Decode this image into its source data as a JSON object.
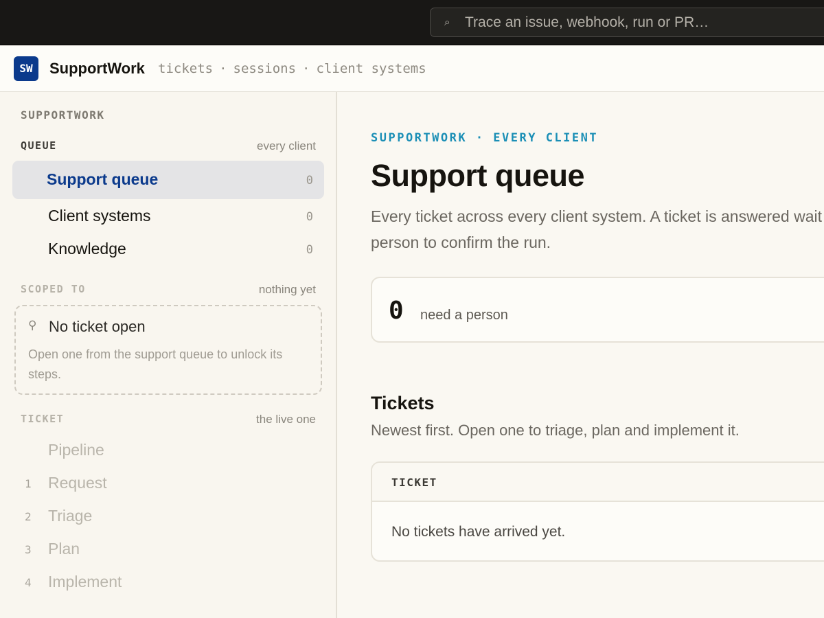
{
  "search": {
    "placeholder": "Trace an issue, webhook, run or PR…",
    "icon": "search-icon"
  },
  "brand": {
    "logo_text": "SW",
    "name": "SupportWork",
    "nav": [
      "tickets",
      "sessions",
      "client systems"
    ],
    "separator": "·",
    "logo_color": "#0b3a8c"
  },
  "sidebar": {
    "title": "SUPPORTWORK",
    "queue": {
      "label": "QUEUE",
      "note": "every client",
      "items": [
        {
          "label": "Support queue",
          "count": "0",
          "active": true
        },
        {
          "label": "Client systems",
          "count": "0",
          "active": false
        },
        {
          "label": "Knowledge",
          "count": "0",
          "active": false
        }
      ]
    },
    "scope": {
      "label": "SCOPED TO",
      "note": "nothing yet",
      "icon": "pin-icon",
      "title": "No ticket open",
      "desc": "Open one from the support queue to unlock its steps."
    },
    "ticket": {
      "label": "TICKET",
      "note": "the live one",
      "heading": "Pipeline",
      "steps": [
        {
          "num": "1",
          "label": "Request"
        },
        {
          "num": "2",
          "label": "Triage"
        },
        {
          "num": "3",
          "label": "Plan"
        },
        {
          "num": "4",
          "label": "Implement"
        }
      ]
    }
  },
  "main": {
    "eyebrow": "SUPPORTWORK · EVERY CLIENT",
    "title": "Support queue",
    "desc": "Every ticket across every client system. A ticket is answered wait for a person to confirm the run.",
    "stat": {
      "value": "0",
      "label": "need a person"
    },
    "tickets": {
      "title": "Tickets",
      "subtitle": "Newest first. Open one to triage, plan and implement it.",
      "column": "TICKET",
      "empty": "No tickets have arrived yet."
    },
    "accent": "#1b8fb6"
  }
}
